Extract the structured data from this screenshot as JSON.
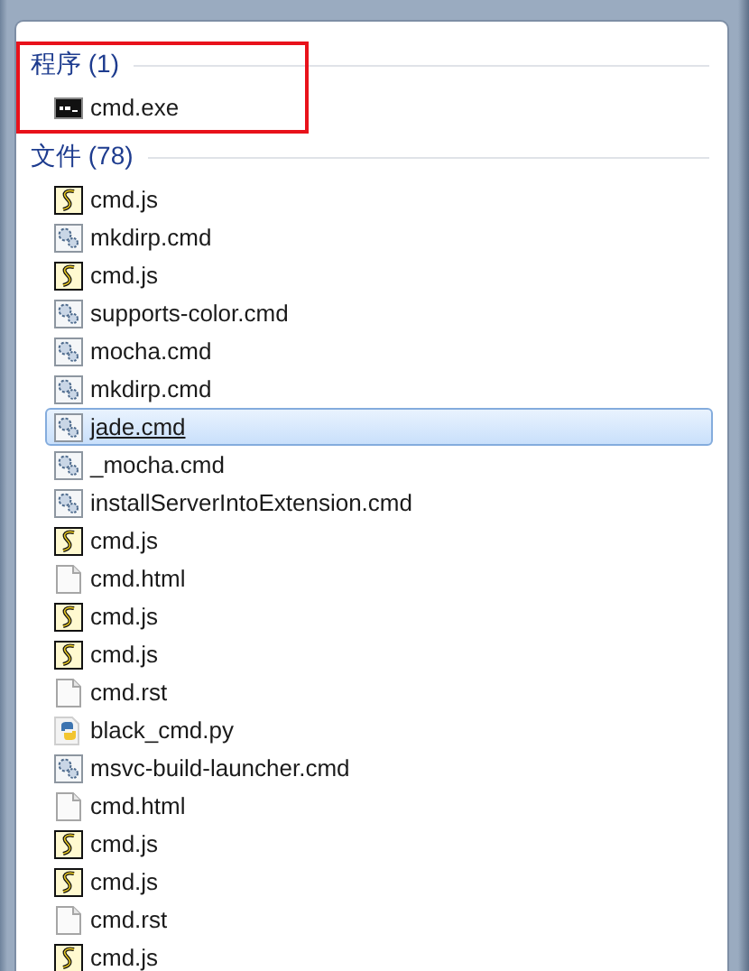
{
  "groups": [
    {
      "title": "程序 (1)",
      "highlighted": true,
      "items": [
        {
          "name": "cmd.exe",
          "kind": "exe",
          "selected": false
        }
      ]
    },
    {
      "title": "文件 (78)",
      "highlighted": false,
      "items": [
        {
          "name": "cmd.js",
          "kind": "js",
          "selected": false
        },
        {
          "name": "mkdirp.cmd",
          "kind": "cmd",
          "selected": false
        },
        {
          "name": "cmd.js",
          "kind": "js",
          "selected": false
        },
        {
          "name": "supports-color.cmd",
          "kind": "cmd",
          "selected": false
        },
        {
          "name": "mocha.cmd",
          "kind": "cmd",
          "selected": false
        },
        {
          "name": "mkdirp.cmd",
          "kind": "cmd",
          "selected": false
        },
        {
          "name": "jade.cmd",
          "kind": "cmd",
          "selected": true
        },
        {
          "name": "_mocha.cmd",
          "kind": "cmd",
          "selected": false
        },
        {
          "name": "installServerIntoExtension.cmd",
          "kind": "cmd",
          "selected": false
        },
        {
          "name": "cmd.js",
          "kind": "js",
          "selected": false
        },
        {
          "name": "cmd.html",
          "kind": "doc",
          "selected": false
        },
        {
          "name": "cmd.js",
          "kind": "js",
          "selected": false
        },
        {
          "name": "cmd.js",
          "kind": "js",
          "selected": false
        },
        {
          "name": "cmd.rst",
          "kind": "doc",
          "selected": false
        },
        {
          "name": "black_cmd.py",
          "kind": "py",
          "selected": false
        },
        {
          "name": "msvc-build-launcher.cmd",
          "kind": "cmd",
          "selected": false
        },
        {
          "name": "cmd.html",
          "kind": "doc",
          "selected": false
        },
        {
          "name": "cmd.js",
          "kind": "js",
          "selected": false
        },
        {
          "name": "cmd.js",
          "kind": "js",
          "selected": false
        },
        {
          "name": "cmd.rst",
          "kind": "doc",
          "selected": false
        },
        {
          "name": "cmd.js",
          "kind": "js",
          "selected": false
        }
      ]
    }
  ]
}
